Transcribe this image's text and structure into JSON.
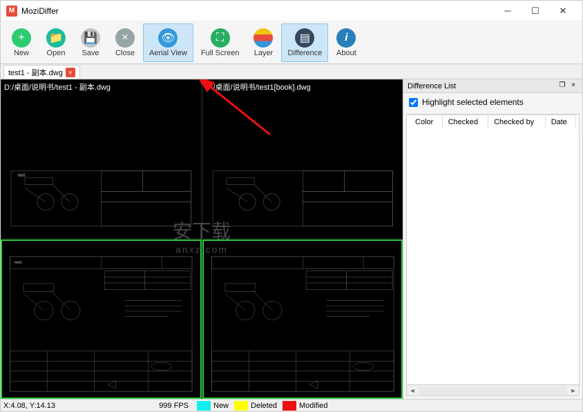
{
  "app": {
    "title": "MoziDiffer"
  },
  "toolbar": {
    "new": "New",
    "open": "Open",
    "save": "Save",
    "close": "Close",
    "aerial": "Aerial View",
    "full": "Full Screen",
    "layer": "Layer",
    "diff": "Difference",
    "about": "About"
  },
  "tabs": [
    {
      "label": "test1 - 副本.dwg"
    }
  ],
  "panes": {
    "top_left_path": "D:/桌面/说明书/test1 - 副本.dwg",
    "top_right_path": "D:/桌面/说明书/test1[book].dwg"
  },
  "watermark": {
    "main": "安下载",
    "sub": "anxz.com"
  },
  "sidepanel": {
    "title": "Difference List",
    "highlight_label": "Highlight selected elements",
    "highlight_checked": true,
    "columns": [
      "Color",
      "Checked",
      "Checked by",
      "Date"
    ]
  },
  "status": {
    "coords": "X:4.08, Y:14.13",
    "fps": "999 FPS",
    "legend": {
      "new": "New",
      "deleted": "Deleted",
      "modified": "Modified"
    }
  }
}
